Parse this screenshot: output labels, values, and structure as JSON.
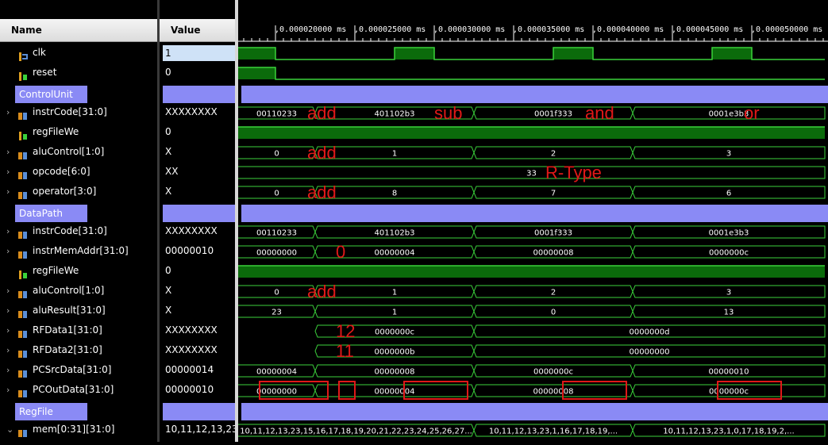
{
  "header": {
    "name_col": "Name",
    "value_col": "Value"
  },
  "time_ticks": [
    {
      "t": 20000,
      "label": ",0.000020000 ms"
    },
    {
      "t": 25000,
      "label": ",0.000025000 ms"
    },
    {
      "t": 30000,
      "label": ",0.000030000 ms"
    },
    {
      "t": 35000,
      "label": ",0.000035000 ms"
    },
    {
      "t": 40000,
      "label": ",0.000040000 ms"
    },
    {
      "t": 45000,
      "label": ",0.000045000 ms"
    },
    {
      "t": 50000,
      "label": ",0.000050000 ms"
    }
  ],
  "colors": {
    "wave": "#3bd23b",
    "high_fill": "#0b6b0b",
    "group": "#8a8af5",
    "annotation": "#e01818"
  },
  "signals": [
    {
      "name": "clk",
      "icon": "clock-icon",
      "expand": "",
      "value": "1",
      "selected": true
    },
    {
      "name": "reset",
      "icon": "bit-icon",
      "expand": "",
      "value": "0"
    },
    {
      "name": "ControlUnit",
      "group": true
    },
    {
      "name": "instrCode[31:0]",
      "icon": "bus-icon",
      "expand": "›",
      "value": "XXXXXXXX"
    },
    {
      "name": "regFileWe",
      "icon": "bit-icon",
      "expand": "",
      "value": "0"
    },
    {
      "name": "aluControl[1:0]",
      "icon": "bus-icon",
      "expand": "›",
      "value": "X"
    },
    {
      "name": "opcode[6:0]",
      "icon": "bus-icon",
      "expand": "›",
      "value": "XX"
    },
    {
      "name": "operator[3:0]",
      "icon": "bus-icon",
      "expand": "›",
      "value": "X"
    },
    {
      "name": "DataPath",
      "group": true
    },
    {
      "name": "instrCode[31:0]",
      "icon": "bus-icon",
      "expand": "›",
      "value": "XXXXXXXX"
    },
    {
      "name": "instrMemAddr[31:0]",
      "icon": "bus-icon",
      "expand": "›",
      "value": "00000010"
    },
    {
      "name": "regFileWe",
      "icon": "bit-icon",
      "expand": "",
      "value": "0"
    },
    {
      "name": "aluControl[1:0]",
      "icon": "bus-icon",
      "expand": "›",
      "value": "X"
    },
    {
      "name": "aluResult[31:0]",
      "icon": "bus-icon",
      "expand": "›",
      "value": "X"
    },
    {
      "name": "RFData1[31:0]",
      "icon": "bus-icon",
      "expand": "›",
      "value": "XXXXXXXX"
    },
    {
      "name": "RFData2[31:0]",
      "icon": "bus-icon",
      "expand": "›",
      "value": "XXXXXXXX"
    },
    {
      "name": "PCSrcData[31:0]",
      "icon": "bus-icon",
      "expand": "›",
      "value": "00000014"
    },
    {
      "name": "PCOutData[31:0]",
      "icon": "bus-icon",
      "expand": "›",
      "value": "00000010"
    },
    {
      "name": "RegFile",
      "group": true
    },
    {
      "name": "mem[0:31][31:0]",
      "icon": "bus-icon",
      "expand": "⌄",
      "value": "10,11,12,13,23,15,16,17,18,19"
    }
  ],
  "waves": [
    {
      "type": "clock",
      "high_from": [
        17500,
        27500,
        37500,
        47500
      ]
    },
    {
      "type": "bit",
      "segments": [
        {
          "from": 17500,
          "to": 20000,
          "level": 1
        },
        {
          "from": 20000,
          "to": 54600,
          "level": 0
        }
      ]
    },
    {
      "type": "group"
    },
    {
      "type": "bus",
      "segments": [
        {
          "from": 17500,
          "to": 22500,
          "label": "00110233"
        },
        {
          "from": 22500,
          "to": 32500,
          "label": "401102b3"
        },
        {
          "from": 32500,
          "to": 42500,
          "label": "0001f333"
        },
        {
          "from": 42500,
          "to": 54600,
          "label": "0001e3b3"
        }
      ]
    },
    {
      "type": "bit",
      "segments": [
        {
          "from": 17500,
          "to": 54600,
          "level": 1
        }
      ]
    },
    {
      "type": "bus",
      "segments": [
        {
          "from": 17500,
          "to": 22500,
          "label": "0"
        },
        {
          "from": 22500,
          "to": 32500,
          "label": "1"
        },
        {
          "from": 32500,
          "to": 42500,
          "label": "2"
        },
        {
          "from": 42500,
          "to": 54600,
          "label": "3"
        }
      ]
    },
    {
      "type": "bus",
      "segments": [
        {
          "from": 17500,
          "to": 54600,
          "label": "33"
        }
      ]
    },
    {
      "type": "bus",
      "segments": [
        {
          "from": 17500,
          "to": 22500,
          "label": "0"
        },
        {
          "from": 22500,
          "to": 32500,
          "label": "8"
        },
        {
          "from": 32500,
          "to": 42500,
          "label": "7"
        },
        {
          "from": 42500,
          "to": 54600,
          "label": "6"
        }
      ]
    },
    {
      "type": "group"
    },
    {
      "type": "bus",
      "segments": [
        {
          "from": 17500,
          "to": 22500,
          "label": "00110233"
        },
        {
          "from": 22500,
          "to": 32500,
          "label": "401102b3"
        },
        {
          "from": 32500,
          "to": 42500,
          "label": "0001f333"
        },
        {
          "from": 42500,
          "to": 54600,
          "label": "0001e3b3"
        }
      ]
    },
    {
      "type": "bus",
      "segments": [
        {
          "from": 17500,
          "to": 22500,
          "label": "00000000"
        },
        {
          "from": 22500,
          "to": 32500,
          "label": "00000004"
        },
        {
          "from": 32500,
          "to": 42500,
          "label": "00000008"
        },
        {
          "from": 42500,
          "to": 54600,
          "label": "0000000c"
        }
      ]
    },
    {
      "type": "bit",
      "segments": [
        {
          "from": 17500,
          "to": 54600,
          "level": 1
        }
      ]
    },
    {
      "type": "bus",
      "segments": [
        {
          "from": 17500,
          "to": 22500,
          "label": "0"
        },
        {
          "from": 22500,
          "to": 32500,
          "label": "1"
        },
        {
          "from": 32500,
          "to": 42500,
          "label": "2"
        },
        {
          "from": 42500,
          "to": 54600,
          "label": "3"
        }
      ]
    },
    {
      "type": "bus",
      "segments": [
        {
          "from": 17500,
          "to": 22500,
          "label": "23"
        },
        {
          "from": 22500,
          "to": 32500,
          "label": "1"
        },
        {
          "from": 32500,
          "to": 42500,
          "label": "0"
        },
        {
          "from": 42500,
          "to": 54600,
          "label": "13"
        }
      ]
    },
    {
      "type": "bus",
      "segments": [
        {
          "from": 22500,
          "to": 32500,
          "label": "0000000c"
        },
        {
          "from": 32500,
          "to": 54600,
          "label": "0000000d"
        }
      ]
    },
    {
      "type": "bus",
      "segments": [
        {
          "from": 22500,
          "to": 32500,
          "label": "0000000b"
        },
        {
          "from": 32500,
          "to": 54600,
          "label": "00000000"
        }
      ]
    },
    {
      "type": "bus",
      "segments": [
        {
          "from": 17500,
          "to": 22500,
          "label": "00000004"
        },
        {
          "from": 22500,
          "to": 32500,
          "label": "00000008"
        },
        {
          "from": 32500,
          "to": 42500,
          "label": "0000000c"
        },
        {
          "from": 42500,
          "to": 54600,
          "label": "00000010"
        }
      ]
    },
    {
      "type": "bus",
      "segments": [
        {
          "from": 17500,
          "to": 22500,
          "label": "00000000"
        },
        {
          "from": 22500,
          "to": 32500,
          "label": "00000004"
        },
        {
          "from": 32500,
          "to": 42500,
          "label": "00000008"
        },
        {
          "from": 42500,
          "to": 54600,
          "label": "0000000c"
        }
      ]
    },
    {
      "type": "group"
    },
    {
      "type": "bus",
      "segments": [
        {
          "from": 17500,
          "to": 32500,
          "label": "10,11,12,13,23,15,16,17,18,19,20,21,22,23,24,25,26,27..."
        },
        {
          "from": 32500,
          "to": 42500,
          "label": "10,11,12,13,23,1,16,17,18,19,..."
        },
        {
          "from": 42500,
          "to": 54600,
          "label": "10,11,12,13,23,1,0,17,18,19,2,..."
        }
      ]
    }
  ],
  "annotations": [
    {
      "text": "add",
      "row": 3,
      "t": 22000
    },
    {
      "text": "sub",
      "row": 3,
      "t": 30000
    },
    {
      "text": "and",
      "row": 3,
      "t": 39500
    },
    {
      "text": "or",
      "row": 3,
      "t": 49500
    },
    {
      "text": "add",
      "row": 5,
      "t": 22000
    },
    {
      "text": "R-Type",
      "row": 6,
      "t": 37000
    },
    {
      "text": "add",
      "row": 7,
      "t": 22000
    },
    {
      "text": "0",
      "row": 10,
      "t": 23800
    },
    {
      "text": "add",
      "row": 12,
      "t": 22000
    },
    {
      "text": "12",
      "row": 14,
      "t": 23800
    },
    {
      "text": "11",
      "row": 15,
      "t": 23800
    }
  ],
  "highlight_boxes": [
    {
      "row": 17,
      "from": 19000,
      "to": 23300
    },
    {
      "row": 17,
      "from": 24000,
      "to": 25000
    },
    {
      "row": 17,
      "from": 28100,
      "to": 32100
    },
    {
      "row": 17,
      "from": 38100,
      "to": 42100
    },
    {
      "row": 17,
      "from": 47850,
      "to": 51850
    }
  ]
}
